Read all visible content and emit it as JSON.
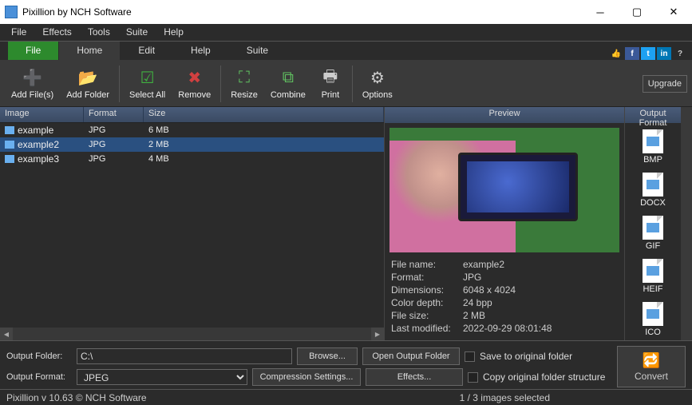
{
  "title": "Pixillion by NCH Software",
  "menu": [
    "File",
    "Effects",
    "Tools",
    "Suite",
    "Help"
  ],
  "tabs": {
    "file": "File",
    "items": [
      "Home",
      "Edit",
      "Help",
      "Suite"
    ],
    "active": 0
  },
  "social_thumb": "👍",
  "toolbar": {
    "items": [
      {
        "label": "Add File(s)",
        "glyph": "➕",
        "color": "#4ac04a"
      },
      {
        "label": "Add Folder",
        "glyph": "📂",
        "color": "#e0b050"
      },
      {
        "sep": true
      },
      {
        "label": "Select All",
        "glyph": "☑",
        "color": "#40b040"
      },
      {
        "label": "Remove",
        "glyph": "✖",
        "color": "#d04040"
      },
      {
        "sep": true
      },
      {
        "label": "Resize",
        "glyph": "⛶",
        "color": "#60c060"
      },
      {
        "label": "Combine",
        "glyph": "⧉",
        "color": "#60c060"
      },
      {
        "label": "Print",
        "glyph": "🖶",
        "color": "#ccc"
      },
      {
        "sep": true
      },
      {
        "label": "Options",
        "glyph": "⚙",
        "color": "#ccc"
      }
    ],
    "upgrade": "Upgrade"
  },
  "cols": {
    "image": "Image",
    "format": "Format",
    "size": "Size"
  },
  "files": [
    {
      "name": "example",
      "format": "JPG",
      "size": "6 MB",
      "sel": false
    },
    {
      "name": "example2",
      "format": "JPG",
      "size": "2 MB",
      "sel": true
    },
    {
      "name": "example3",
      "format": "JPG",
      "size": "4 MB",
      "sel": false
    }
  ],
  "preview": {
    "head": "Preview",
    "meta": [
      {
        "l": "File name:",
        "v": "example2"
      },
      {
        "l": "Format:",
        "v": "JPG"
      },
      {
        "l": "Dimensions:",
        "v": "6048 x 4024"
      },
      {
        "l": "Color depth:",
        "v": "24 bpp"
      },
      {
        "l": "File size:",
        "v": "2 MB"
      },
      {
        "l": "Last modified:",
        "v": "2022-09-29 08:01:48"
      }
    ]
  },
  "formats": {
    "head": "Output Format",
    "items": [
      "BMP",
      "DOCX",
      "GIF",
      "HEIF",
      "ICO"
    ]
  },
  "bottom": {
    "folderL": "Output Folder:",
    "folderV": "C:\\",
    "browse": "Browse...",
    "open": "Open Output Folder",
    "save": "Save to original folder",
    "copy": "Copy original folder structure",
    "formatL": "Output Format:",
    "formatV": "JPEG",
    "comp": "Compression Settings...",
    "fx": "Effects...",
    "convert": "Convert"
  },
  "status": {
    "left": "Pixillion v 10.63 © NCH Software",
    "right": "1 / 3 images selected"
  }
}
